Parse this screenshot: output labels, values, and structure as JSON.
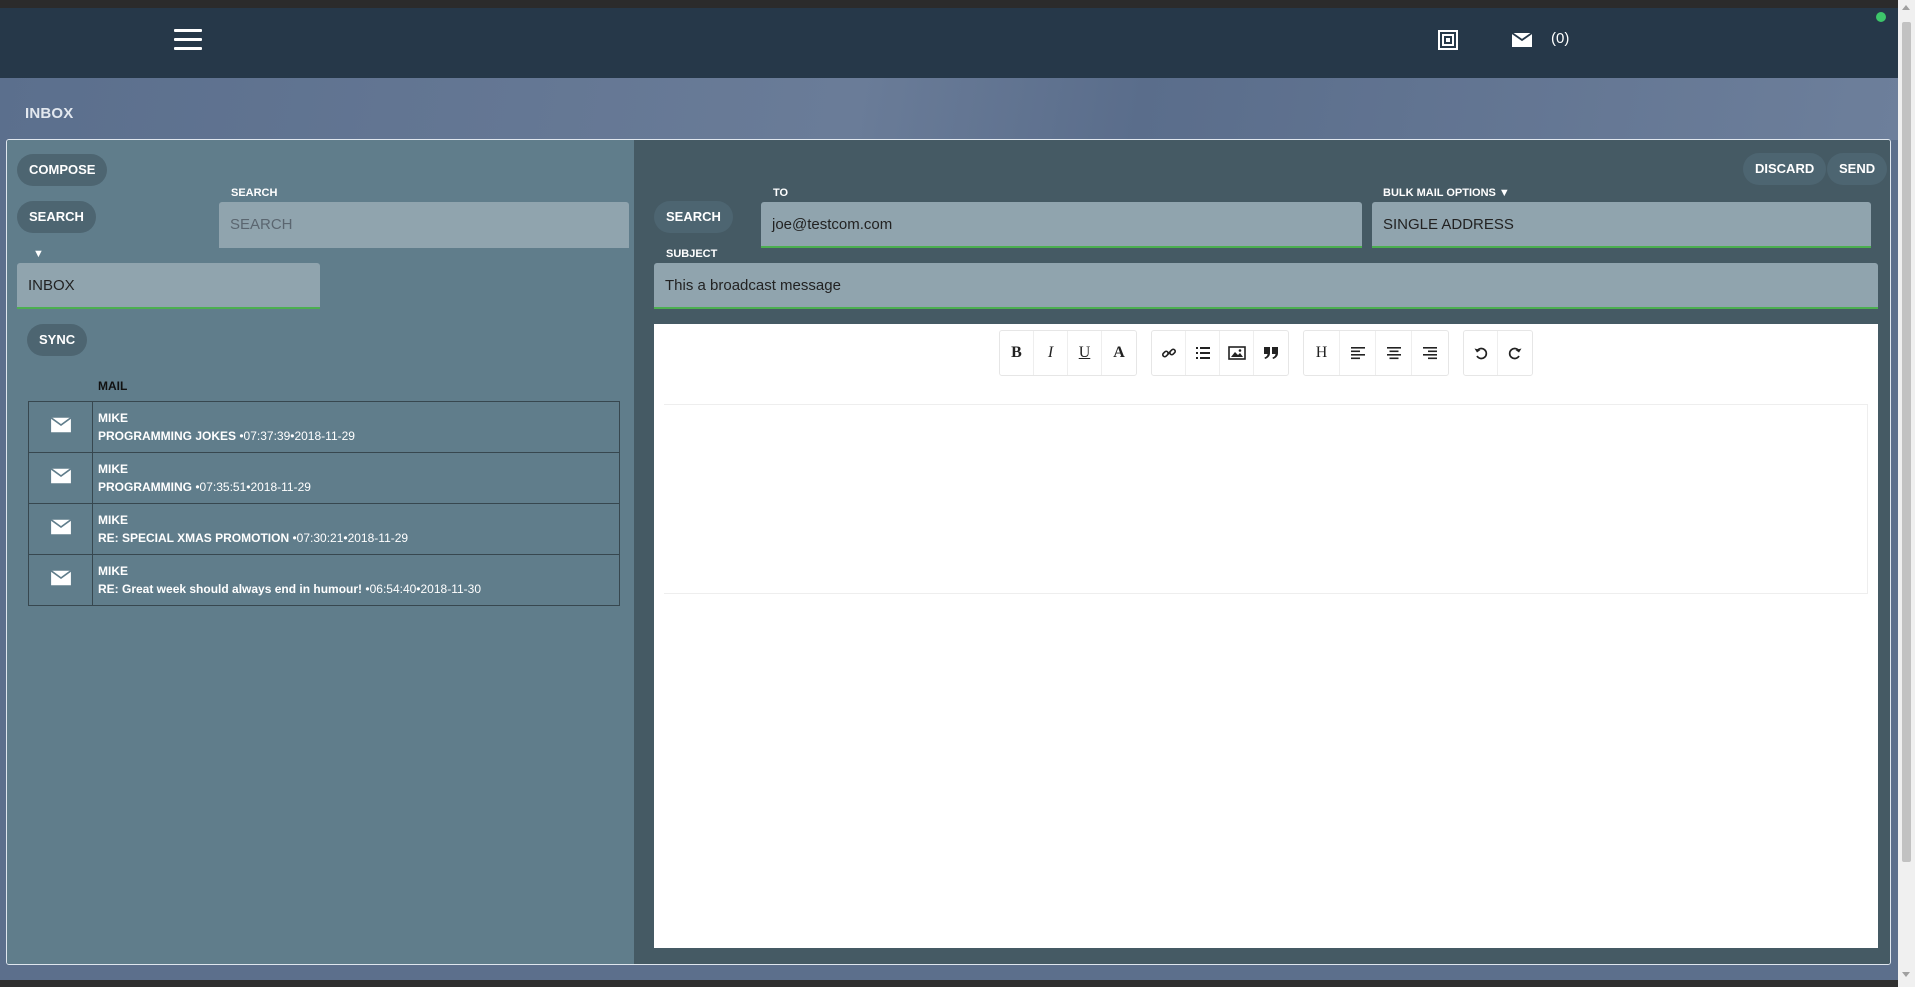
{
  "header": {
    "mail_count": "(0)",
    "icons": {
      "menu": "hamburger-icon",
      "notes": "notes-icon",
      "mail": "mail-icon"
    },
    "status_color": "#3dc66a"
  },
  "page": {
    "title": "INBOX"
  },
  "left": {
    "compose_label": "COMPOSE",
    "search_button_label": "SEARCH",
    "search_field_label": "SEARCH",
    "search_placeholder": "SEARCH",
    "folder_caret": "▼",
    "folder_value": "INBOX",
    "sync_label": "SYNC",
    "mail_column_header": "MAIL",
    "mails": [
      {
        "from": "MIKE",
        "subject": "PROGRAMMING JOKES",
        "meta": " •07:37:39•2018-11-29"
      },
      {
        "from": "MIKE",
        "subject": "PROGRAMMING",
        "meta": " •07:35:51•2018-11-29"
      },
      {
        "from": "MIKE",
        "subject": "RE: SPECIAL XMAS PROMOTION",
        "meta": " •07:30:21•2018-11-29"
      },
      {
        "from": "MIKE",
        "subject": "RE: Great week should always end in humour!",
        "meta": " •06:54:40•2018-11-30"
      }
    ]
  },
  "compose": {
    "discard_label": "DISCARD",
    "send_label": "SEND",
    "search_label": "SEARCH",
    "to_label": "TO",
    "to_value": "joe@testcom.com",
    "bulk_label": "BULK MAIL OPTIONS ▼",
    "bulk_value": "SINGLE ADDRESS",
    "subject_label": "SUBJECT",
    "subject_value": "This a broadcast message"
  },
  "toolbar": {
    "bold": "B",
    "italic": "I",
    "underline": "U",
    "font_color": "A",
    "heading": "H"
  },
  "colors": {
    "header_bg": "#263849",
    "left_pane_bg": "#607d8b",
    "right_pane_bg": "#455a64",
    "field_bg": "#90a4ae",
    "accent_green": "#4caf50"
  }
}
